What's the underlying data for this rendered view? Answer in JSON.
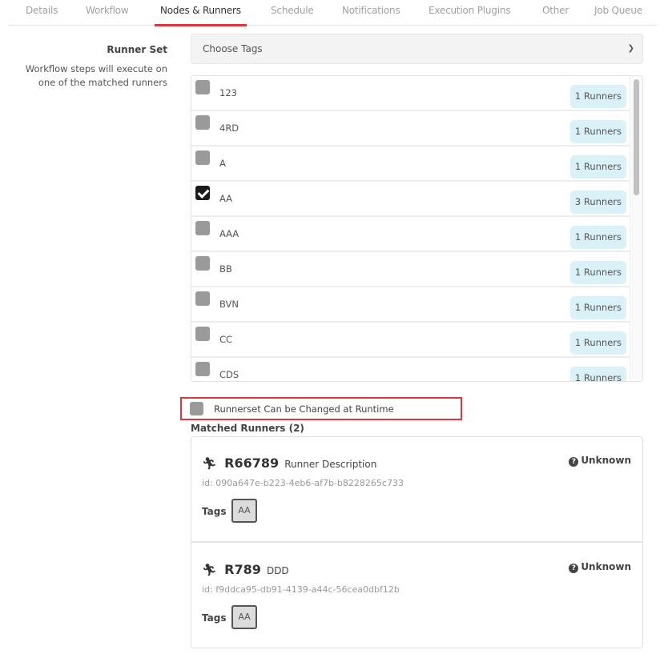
{
  "tabs": [
    {
      "label": "Details",
      "active": false
    },
    {
      "label": "Workflow",
      "active": false
    },
    {
      "label": "Nodes & Runners",
      "active": true
    },
    {
      "label": "Schedule",
      "active": false
    },
    {
      "label": "Notifications",
      "active": false
    },
    {
      "label": "Execution Plugins",
      "active": false
    },
    {
      "label": "Other",
      "active": false
    },
    {
      "label": "Job Queue",
      "active": false
    }
  ],
  "runner_set": {
    "label": "Runner Set",
    "help_line1": "Workflow steps will execute on",
    "help_line2": "one of the matched runners",
    "select_placeholder": "Choose Tags",
    "select_icon": "chevron-down-icon"
  },
  "tag_list": [
    {
      "name": "123",
      "count": "1 Runners",
      "checked": false
    },
    {
      "name": "4RD",
      "count": "1 Runners",
      "checked": false
    },
    {
      "name": "A",
      "count": "1 Runners",
      "checked": false
    },
    {
      "name": "AA",
      "count": "3 Runners",
      "checked": true
    },
    {
      "name": "AAA",
      "count": "1 Runners",
      "checked": false
    },
    {
      "name": "BB",
      "count": "1 Runners",
      "checked": false
    },
    {
      "name": "BVN",
      "count": "1 Runners",
      "checked": false
    },
    {
      "name": "CC",
      "count": "1 Runners",
      "checked": false
    },
    {
      "name": "CDS",
      "count": "1 Runners",
      "checked": false
    }
  ],
  "runtime_option": {
    "label": "Runnerset Can be Changed at Runtime",
    "checked": false
  },
  "matched": {
    "title": "Matched Runners (2)",
    "runners": [
      {
        "icon": "running-person-icon",
        "name": "R66789",
        "description": "Runner Description",
        "id": "id: 090a647e-b223-4eb6-af7b-b8228265c733",
        "tags_label": "Tags",
        "tags": [
          "AA"
        ],
        "status": "Unknown",
        "status_icon": "question-circle-icon"
      },
      {
        "icon": "running-person-icon",
        "name": "R789",
        "description": "DDD",
        "id": "id: f9ddca95-db91-4139-a44c-56cea0dbf12b",
        "tags_label": "Tags",
        "tags": [
          "AA"
        ],
        "status": "Unknown",
        "status_icon": "question-circle-icon"
      }
    ]
  },
  "colors": {
    "accent": "#e0353a",
    "badge_bg": "#d9f1f7",
    "checkbox_unchecked": "#9a9a9a",
    "checkbox_checked": "#1a1a1a"
  }
}
